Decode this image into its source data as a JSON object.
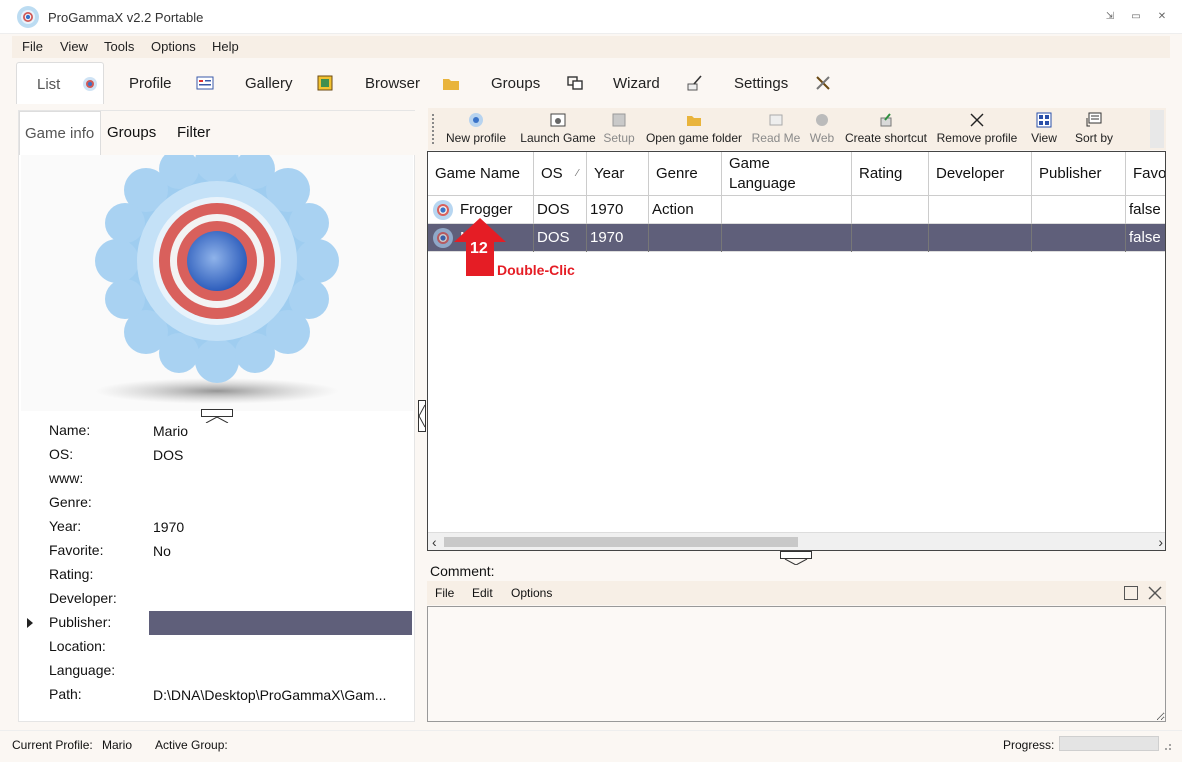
{
  "app": {
    "title": "ProGammaX v2.2 Portable",
    "window_buttons": [
      "⇲",
      "▭",
      "✕"
    ]
  },
  "menu": [
    "File",
    "View",
    "Tools",
    "Options",
    "Help"
  ],
  "main_tabs": [
    "List",
    "Profile",
    "Gallery",
    "Browser",
    "Groups",
    "Wizard",
    "Settings"
  ],
  "left_tabs": [
    "Game info",
    "Groups",
    "Filter"
  ],
  "game_info": [
    {
      "key": "Name:",
      "value": "Mario"
    },
    {
      "key": "OS:",
      "value": "DOS"
    },
    {
      "key": "www:",
      "value": ""
    },
    {
      "key": "Genre:",
      "value": ""
    },
    {
      "key": "Year:",
      "value": "1970"
    },
    {
      "key": "Favorite:",
      "value": "No"
    },
    {
      "key": "Rating:",
      "value": ""
    },
    {
      "key": "Developer:",
      "value": ""
    },
    {
      "key": "Publisher:",
      "value": ""
    },
    {
      "key": "Location:",
      "value": ""
    },
    {
      "key": "Language:",
      "value": ""
    },
    {
      "key": "Path:",
      "value": "D:\\DNA\\Desktop\\ProGammaX\\Gam..."
    }
  ],
  "toolbar": [
    {
      "label": "New profile",
      "icon": "new-profile-icon",
      "enabled": true
    },
    {
      "label": "Launch Game",
      "icon": "launch-game-icon",
      "enabled": true
    },
    {
      "label": "Setup",
      "icon": "setup-icon",
      "enabled": false
    },
    {
      "label": "Open game folder",
      "icon": "folder-icon",
      "enabled": true
    },
    {
      "label": "Read Me",
      "icon": "readme-icon",
      "enabled": false
    },
    {
      "label": "Web",
      "icon": "web-icon",
      "enabled": false
    },
    {
      "label": "Create shortcut",
      "icon": "shortcut-icon",
      "enabled": true
    },
    {
      "label": "Remove profile",
      "icon": "remove-icon",
      "enabled": true
    },
    {
      "label": "View",
      "icon": "view-icon",
      "enabled": true
    },
    {
      "label": "Sort by",
      "icon": "sort-icon",
      "enabled": true
    }
  ],
  "grid": {
    "columns": [
      "Game Name",
      "OS",
      "Year",
      "Genre",
      "Game Language",
      "Rating",
      "Developer",
      "Publisher",
      "Favor"
    ],
    "sort_glyph": "⁄",
    "rows": [
      [
        "Frogger",
        "DOS",
        "1970",
        "Action",
        "",
        "",
        "",
        "",
        "false"
      ],
      [
        "Mario",
        "DOS",
        "1970",
        "",
        "",
        "",
        "",
        "",
        "false"
      ]
    ],
    "selected_row": 1
  },
  "comment": {
    "label": "Comment:",
    "menu": [
      "File",
      "Edit",
      "Options"
    ]
  },
  "status": {
    "current_profile_label": "Current Profile:",
    "current_profile": "Mario",
    "active_group_label": "Active Group:",
    "active_group": "",
    "progress_label": "Progress:",
    "progress": 0
  },
  "annotation": {
    "step": "12",
    "text": "Double-Clic",
    "color": "#e51d25"
  },
  "colors": {
    "selection": "#5f5f7a",
    "menu_bg": "#f7efe6"
  }
}
